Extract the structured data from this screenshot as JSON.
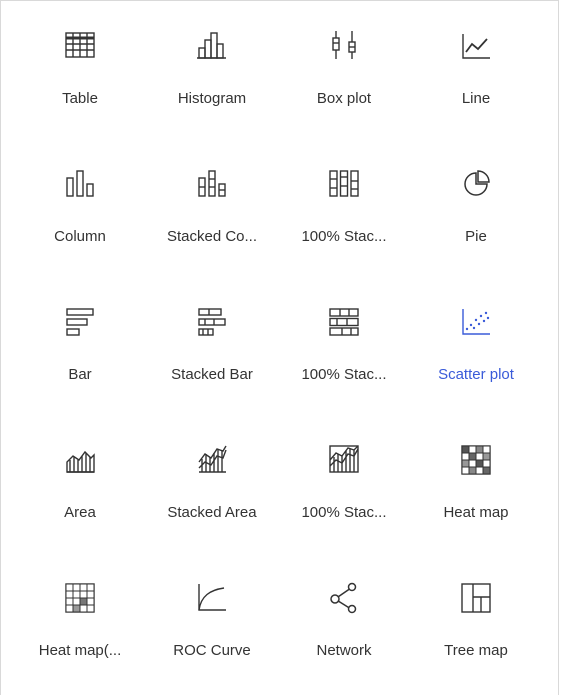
{
  "accent_color": "#3a5bd9",
  "selected_item": "scatter-plot",
  "items": [
    {
      "label": "Table",
      "icon": "table-icon"
    },
    {
      "label": "Histogram",
      "icon": "histogram-icon"
    },
    {
      "label": "Box plot",
      "icon": "box-plot-icon"
    },
    {
      "label": "Line",
      "icon": "line-chart-icon"
    },
    {
      "label": "Column",
      "icon": "column-chart-icon"
    },
    {
      "label": "Stacked Co...",
      "icon": "stacked-column-icon"
    },
    {
      "label": "100% Stac...",
      "icon": "100-stacked-column-icon"
    },
    {
      "label": "Pie",
      "icon": "pie-chart-icon"
    },
    {
      "label": "Bar",
      "icon": "bar-chart-icon"
    },
    {
      "label": "Stacked Bar",
      "icon": "stacked-bar-icon"
    },
    {
      "label": "100% Stac...",
      "icon": "100-stacked-bar-icon"
    },
    {
      "label": "Scatter plot",
      "icon": "scatter-plot-icon"
    },
    {
      "label": "Area",
      "icon": "area-chart-icon"
    },
    {
      "label": "Stacked Area",
      "icon": "stacked-area-icon"
    },
    {
      "label": "100% Stac...",
      "icon": "100-stacked-area-icon"
    },
    {
      "label": "Heat map",
      "icon": "heat-map-icon"
    },
    {
      "label": "Heat map(...",
      "icon": "heat-map-alt-icon"
    },
    {
      "label": "ROC Curve",
      "icon": "roc-curve-icon"
    },
    {
      "label": "Network",
      "icon": "network-icon"
    },
    {
      "label": "Tree map",
      "icon": "tree-map-icon"
    }
  ]
}
